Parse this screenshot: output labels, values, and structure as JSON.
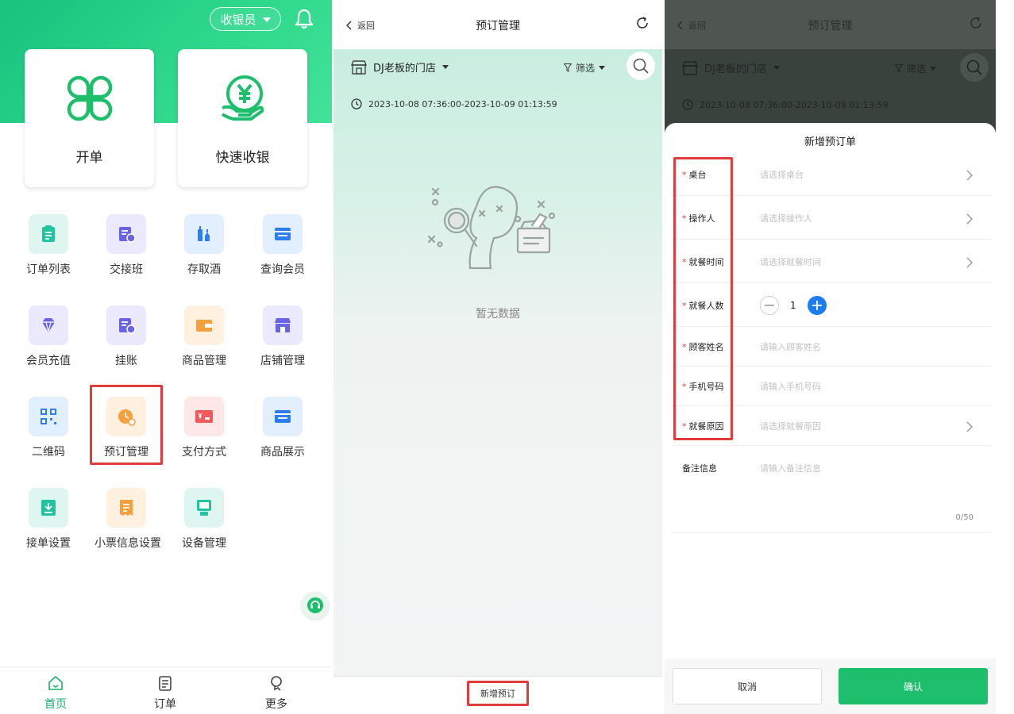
{
  "home": {
    "cashier_label": "收银员",
    "big_cards": [
      {
        "label": "开单",
        "icon": "clover-icon"
      },
      {
        "label": "快速收银",
        "icon": "yuan-hand-icon"
      }
    ],
    "grid": [
      {
        "label": "订单列表",
        "icon": "order-list-icon",
        "bg": "#dff6f0",
        "fg": "#22c3a0"
      },
      {
        "label": "交接班",
        "icon": "shift-handover-icon",
        "bg": "#ebeafd",
        "fg": "#6b63e6"
      },
      {
        "label": "存取酒",
        "icon": "wine-storage-icon",
        "bg": "#e2efff",
        "fg": "#2d7ef2"
      },
      {
        "label": "查询会员",
        "icon": "member-query-icon",
        "bg": "#e2efff",
        "fg": "#2d7ef2"
      },
      {
        "label": "会员充值",
        "icon": "diamond-icon",
        "bg": "#ebeafd",
        "fg": "#6b63e6"
      },
      {
        "label": "挂账",
        "icon": "credit-icon",
        "bg": "#ebeafd",
        "fg": "#6b63e6"
      },
      {
        "label": "商品管理",
        "icon": "wallet-icon",
        "bg": "#fff0e0",
        "fg": "#f5a03c"
      },
      {
        "label": "店铺管理",
        "icon": "store-icon",
        "bg": "#ebeafd",
        "fg": "#6b63e6"
      },
      {
        "label": "二维码",
        "icon": "qrcode-icon",
        "bg": "#e2efff",
        "fg": "#2d7ef2"
      },
      {
        "label": "预订管理",
        "icon": "reservation-clock-icon",
        "bg": "#fff0e0",
        "fg": "#f5a03c"
      },
      {
        "label": "支付方式",
        "icon": "payment-card-icon",
        "bg": "#ffe7e7",
        "fg": "#f05a5a"
      },
      {
        "label": "商品展示",
        "icon": "product-display-icon",
        "bg": "#e2efff",
        "fg": "#2d7ef2"
      },
      {
        "label": "接单设置",
        "icon": "order-receive-icon",
        "bg": "#dff6f0",
        "fg": "#22c3a0"
      },
      {
        "label": "小票信息设置",
        "icon": "receipt-icon",
        "bg": "#fff0e0",
        "fg": "#f5a03c"
      },
      {
        "label": "设备管理",
        "icon": "device-icon",
        "bg": "#dff6f0",
        "fg": "#22c3a0"
      }
    ],
    "tabs": [
      {
        "label": "首页",
        "icon": "home-icon",
        "active": true
      },
      {
        "label": "订单",
        "icon": "order-icon",
        "active": false
      },
      {
        "label": "更多",
        "icon": "more-icon",
        "active": false
      }
    ]
  },
  "reservation": {
    "back_label": "返回",
    "title": "预订管理",
    "store_name": "DJ老板的门店",
    "filter_label": "筛选",
    "date_range": "2023-10-08 07:36:00-2023-10-09 01:13:59",
    "empty_text": "暂无数据",
    "add_button": "新增预订"
  },
  "new_order": {
    "title": "新增预订单",
    "fields": [
      {
        "label": "桌台",
        "placeholder": "请选择桌台",
        "required": true,
        "arrow": true
      },
      {
        "label": "操作人",
        "placeholder": "请选择操作人",
        "required": true,
        "arrow": true
      },
      {
        "label": "就餐时间",
        "placeholder": "请选择就餐时间",
        "required": true,
        "arrow": true
      },
      {
        "label": "就餐人数",
        "placeholder": "",
        "required": true,
        "arrow": false
      },
      {
        "label": "顾客姓名",
        "placeholder": "请输入顾客姓名",
        "required": true,
        "arrow": false
      },
      {
        "label": "手机号码",
        "placeholder": "请输入手机号码",
        "required": true,
        "arrow": false
      },
      {
        "label": "就餐原因",
        "placeholder": "请选择就餐原因",
        "required": true,
        "arrow": true
      },
      {
        "label": "备注信息",
        "placeholder": "请输入备注信息",
        "required": false,
        "arrow": false
      }
    ],
    "guest_count": "1",
    "char_counter": "0/50",
    "cancel_label": "取消",
    "confirm_label": "确认"
  },
  "colors": {
    "brand_green": "#1dbf6c",
    "highlight_red": "#e23b3b",
    "stepper_blue": "#1c7cf2"
  }
}
